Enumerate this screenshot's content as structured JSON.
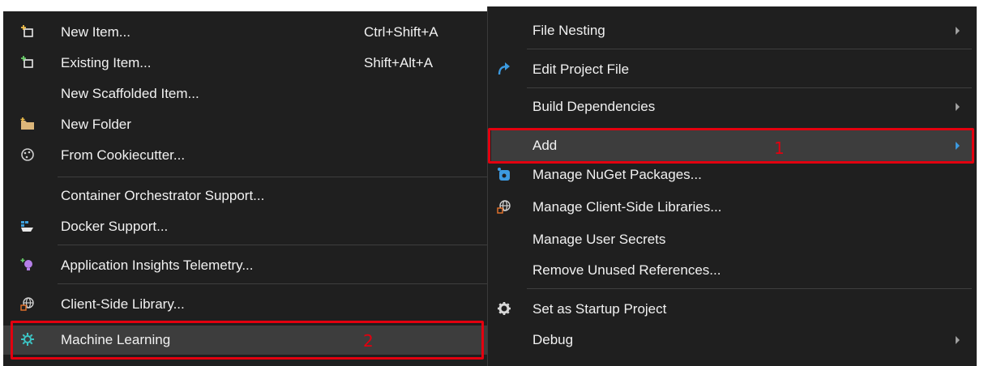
{
  "submenu": {
    "items": [
      {
        "label": "New Item...",
        "shortcut": "Ctrl+Shift+A",
        "icon": "new-item-icon"
      },
      {
        "label": "Existing Item...",
        "shortcut": "Shift+Alt+A",
        "icon": "existing-item-icon"
      },
      {
        "label": "New Scaffolded Item..."
      },
      {
        "label": "New Folder",
        "icon": "folder-icon"
      },
      {
        "label": "From Cookiecutter...",
        "icon": "cookiecutter-icon"
      },
      {
        "label": "Container Orchestrator Support..."
      },
      {
        "label": "Docker Support...",
        "icon": "docker-icon"
      },
      {
        "label": "Application Insights Telemetry...",
        "icon": "lightbulb-icon"
      },
      {
        "label": "Client-Side Library...",
        "icon": "globe-icon"
      },
      {
        "label": "Machine Learning",
        "icon": "ml-gear-icon"
      }
    ],
    "callout_number": "2"
  },
  "context_menu": {
    "items": [
      {
        "label": "File Nesting",
        "has_submenu": true
      },
      {
        "label": "Edit Project File",
        "icon": "redo-arrow-icon"
      },
      {
        "label": "Build Dependencies",
        "has_submenu": true
      },
      {
        "label": "Add",
        "has_submenu": true,
        "highlighted": true
      },
      {
        "label": "Manage NuGet Packages...",
        "icon": "nuget-icon"
      },
      {
        "label": "Manage Client-Side Libraries...",
        "icon": "globe-icon"
      },
      {
        "label": "Manage User Secrets"
      },
      {
        "label": "Remove Unused References..."
      },
      {
        "label": "Set as Startup Project",
        "icon": "gear-icon"
      },
      {
        "label": "Debug",
        "has_submenu": true
      }
    ],
    "callout_number": "1"
  },
  "colors": {
    "menu_background": "#1f1f1f",
    "highlight": "#3d3d3d",
    "callout": "#e3000f",
    "text": "#f1f1f1"
  }
}
